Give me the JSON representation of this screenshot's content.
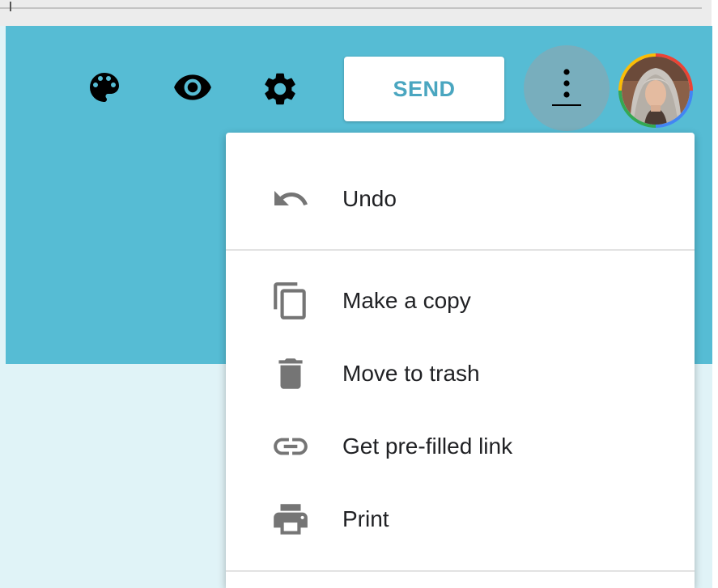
{
  "toolbar": {
    "send_label": "SEND",
    "icons": [
      "palette-icon",
      "eye-icon",
      "gear-icon",
      "more-vert-icon"
    ]
  },
  "menu": {
    "items": [
      {
        "label": "Undo",
        "icon": "undo-icon"
      },
      {
        "label": "Make a copy",
        "icon": "copy-icon"
      },
      {
        "label": "Move to trash",
        "icon": "trash-icon"
      },
      {
        "label": "Get pre-filled link",
        "icon": "link-icon"
      },
      {
        "label": "Print",
        "icon": "print-icon"
      }
    ]
  },
  "colors": {
    "header": "#56bcd4",
    "body_background": "#e0f3f7",
    "send_text": "#4aa6c0",
    "icon_gray": "#757575",
    "text": "#202124"
  }
}
